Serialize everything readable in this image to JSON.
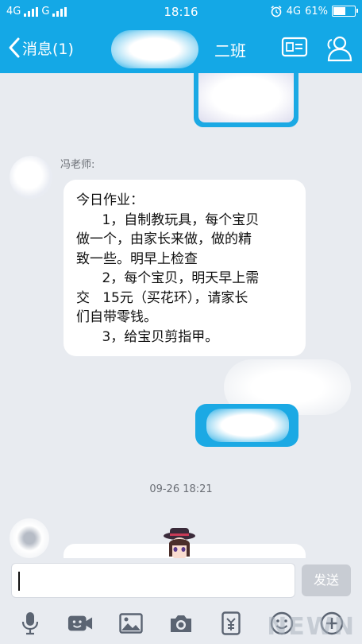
{
  "status": {
    "network_left": "4G",
    "carrier2": "G",
    "time": "18:16",
    "network_right": "4G",
    "battery": "61%",
    "battery_level": 0.61
  },
  "header": {
    "back_label": "消息(1)",
    "title": "二班"
  },
  "chat": {
    "sender_name": "冯老师:",
    "message_lines": [
      "今日作业：",
      "      1，自制教玩具，每个宝贝",
      "做一个，由家长来做，做的精",
      "致一些。明早上检查",
      "      2，每个宝贝，明天早上需",
      "交   15元（买花环），请家长",
      "们自带零钱。",
      "      3，给宝贝剪指甲。"
    ],
    "timestamp": "09-26 18:21"
  },
  "input": {
    "placeholder": "",
    "send_label": "发送"
  },
  "toolbar": {
    "items": [
      "microphone-icon",
      "video-face-icon",
      "image-icon",
      "camera-icon",
      "red-packet-icon",
      "emoji-icon",
      "plus-icon"
    ]
  },
  "watermark": "NEWN"
}
